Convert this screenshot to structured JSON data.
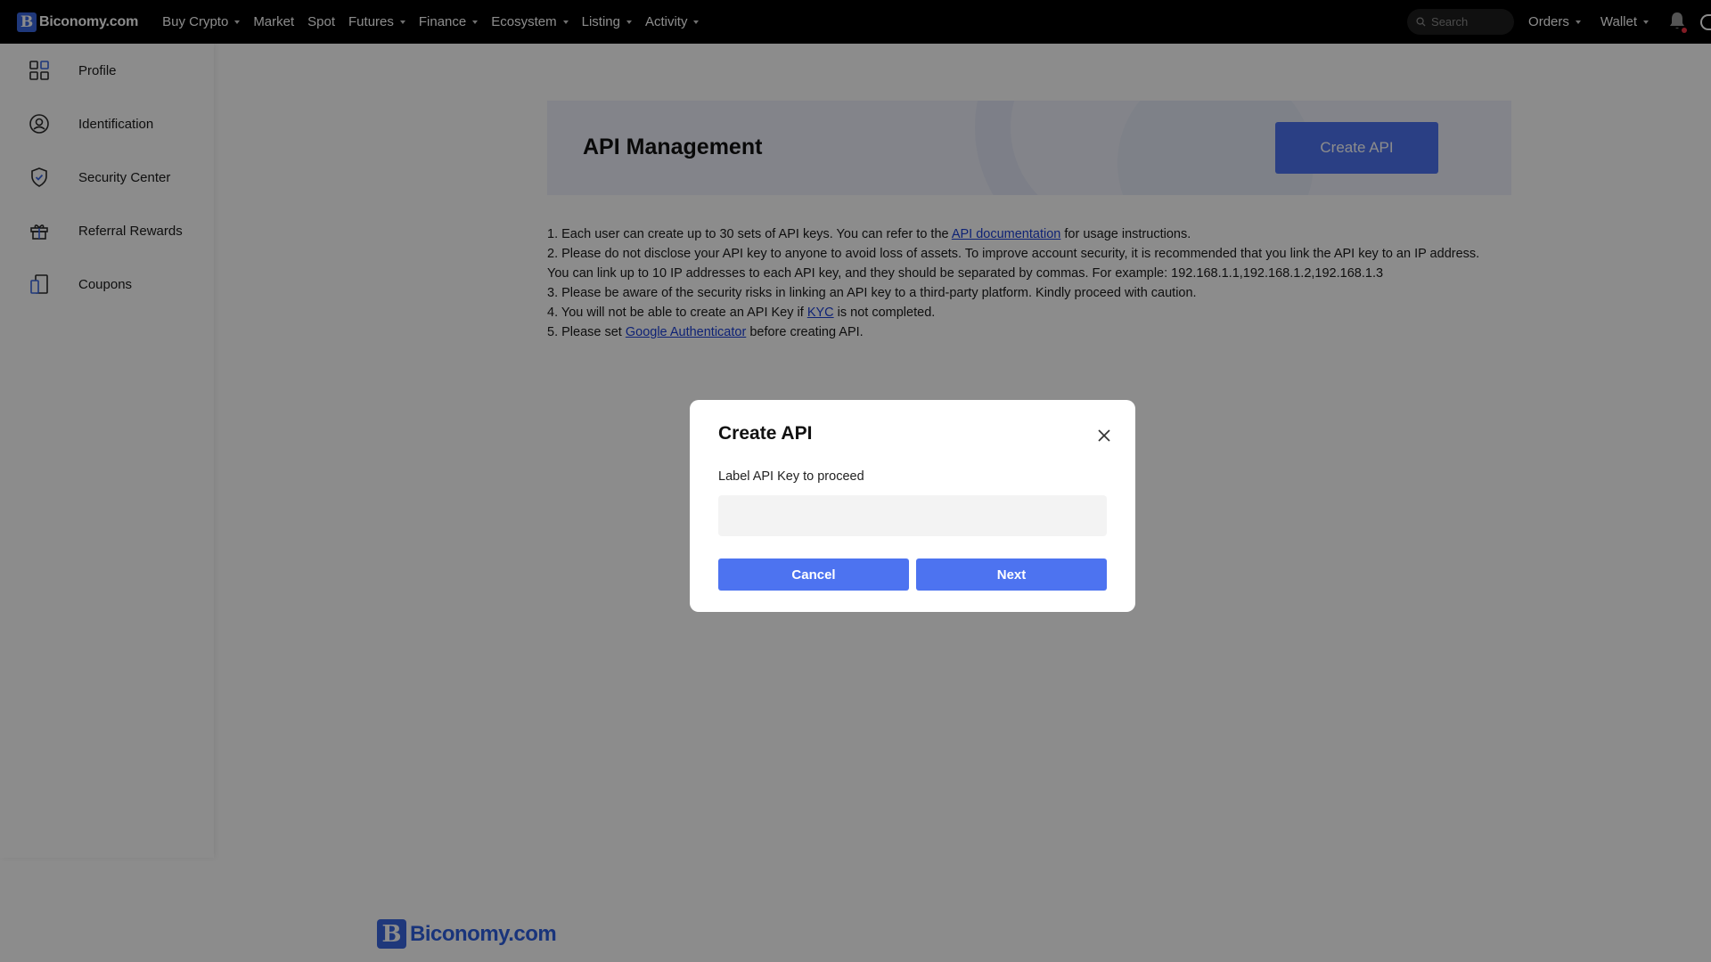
{
  "header": {
    "logo_text": "Biconomy.com",
    "logo_mark": "B",
    "nav": [
      {
        "label": "Buy Crypto",
        "dropdown": true
      },
      {
        "label": "Market",
        "dropdown": false
      },
      {
        "label": "Spot",
        "dropdown": false
      },
      {
        "label": "Futures",
        "dropdown": true
      },
      {
        "label": "Finance",
        "dropdown": true
      },
      {
        "label": "Ecosystem",
        "dropdown": true
      },
      {
        "label": "Listing",
        "dropdown": true
      },
      {
        "label": "Activity",
        "dropdown": true
      }
    ],
    "search_placeholder": "Search",
    "orders_label": "Orders",
    "wallet_label": "Wallet"
  },
  "sidebar": {
    "items": [
      {
        "label": "Profile",
        "icon": "grid-icon"
      },
      {
        "label": "Identification",
        "icon": "user-circle-icon"
      },
      {
        "label": "Security Center",
        "icon": "shield-check-icon"
      },
      {
        "label": "Referral Rewards",
        "icon": "gift-icon"
      },
      {
        "label": "Coupons",
        "icon": "coupon-icon"
      }
    ]
  },
  "main": {
    "title": "API Management",
    "create_button": "Create API",
    "notes": {
      "n1_before": "1. Each user can create up to 30 sets of API keys. You can refer to the ",
      "n1_link": "API documentation",
      "n1_after": " for usage instructions.",
      "n2_line1": "2. Please do not disclose your API key to anyone to avoid loss of assets. To improve account security, it is recommended that you link the API key to an IP address.",
      "n2_line2": "You can link up to 10 IP addresses to each API key, and they should be separated by commas. For example: 192.168.1.1,192.168.1.2,192.168.1.3",
      "n3": "3. Please be aware of the security risks in linking an API key to a third-party platform. Kindly proceed with caution.",
      "n4_before": "4. You will not be able to create an API Key if ",
      "n4_link": "KYC",
      "n4_after": " is not completed.",
      "n5_before": "5. Please set ",
      "n5_link": "Google Authenticator",
      "n5_after": " before creating API."
    }
  },
  "footer": {
    "logo_text": "Biconomy.com",
    "logo_mark": "B"
  },
  "modal": {
    "title": "Create API",
    "label": "Label API Key to proceed",
    "input_value": "",
    "input_placeholder": "",
    "cancel_label": "Cancel",
    "next_label": "Next"
  },
  "colors": {
    "accent": "#4d73f0",
    "topbar": "#000000",
    "overlay": "rgba(0,0,0,0.45)"
  }
}
